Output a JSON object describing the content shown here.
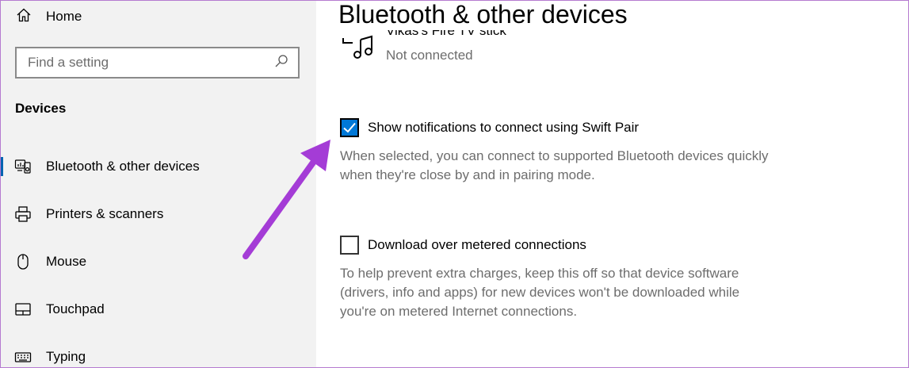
{
  "sidebar": {
    "home_label": "Home",
    "search_placeholder": "Find a setting",
    "section_title": "Devices",
    "items": [
      {
        "label": "Bluetooth & other devices",
        "icon": "bluetooth-devices-icon",
        "active": true
      },
      {
        "label": "Printers & scanners",
        "icon": "printer-icon",
        "active": false
      },
      {
        "label": "Mouse",
        "icon": "mouse-icon",
        "active": false
      },
      {
        "label": "Touchpad",
        "icon": "touchpad-icon",
        "active": false
      },
      {
        "label": "Typing",
        "icon": "keyboard-icon",
        "active": false
      }
    ]
  },
  "main": {
    "title": "Bluetooth & other devices",
    "device": {
      "name": "Vikas's Fire TV stick",
      "status": "Not connected",
      "icon": "audio-device-icon"
    },
    "swift_pair": {
      "label": "Show notifications to connect using Swift Pair",
      "checked": true,
      "description_line1": "When selected, you can connect to supported Bluetooth devices quickly",
      "description_line2": "when they're close by and in pairing mode."
    },
    "metered": {
      "label": "Download over metered connections",
      "checked": false,
      "description_line1": "To help prevent extra charges, keep this off so that device software",
      "description_line2": "(drivers, info and apps) for new devices won't be downloaded while",
      "description_line3": "you're on metered Internet connections."
    }
  },
  "colors": {
    "accent": "#0078d7",
    "active_indicator": "#0063b1",
    "sidebar_bg": "#f2f2f2",
    "annotation_arrow": "#a43cd6",
    "secondary_text": "#6d6d6d"
  }
}
